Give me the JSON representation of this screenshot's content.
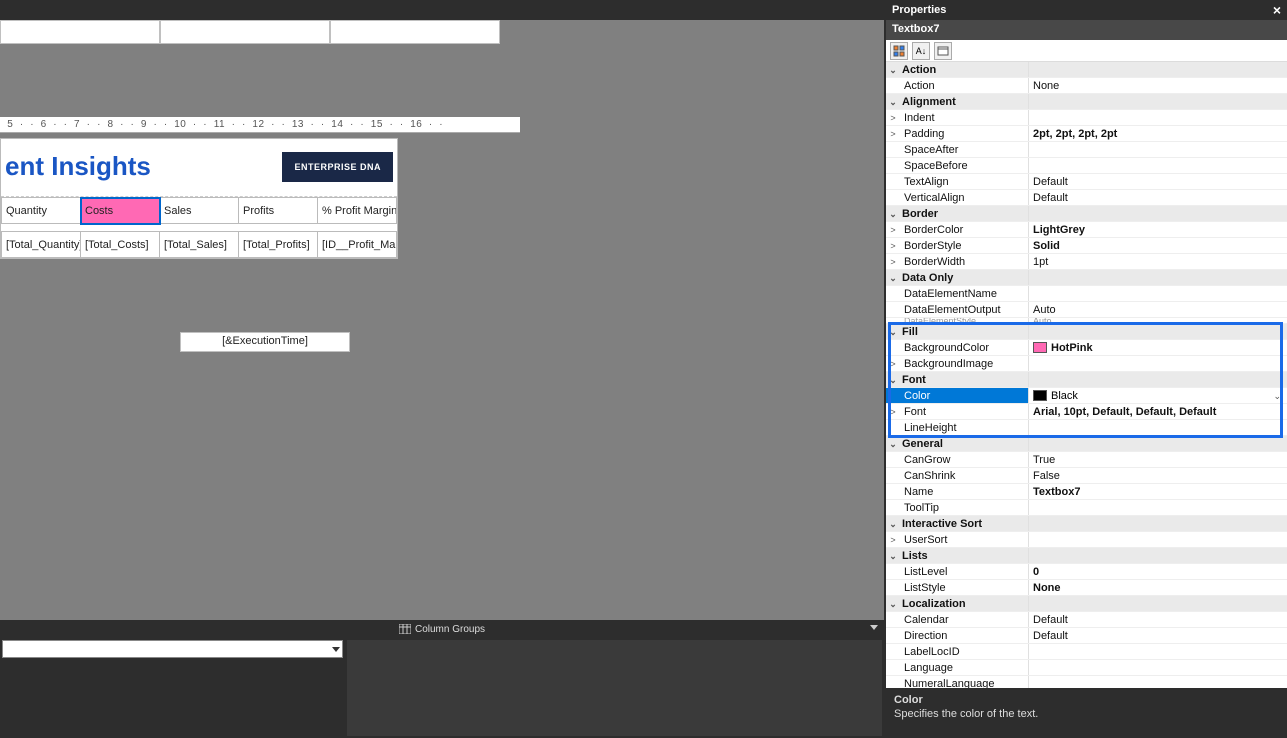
{
  "app": {
    "properties_title": "Properties",
    "object_name": "Textbox7"
  },
  "ruler": " 5  ·  ·  6  ·  ·  7  ·  ·  8  ·  ·  9  ·  ·  10  ·  ·  11  ·  ·  12  ·  ·  13  ·  ·  14  ·  ·  15  ·  ·  16  ·  ·",
  "report": {
    "title": "ent Insights",
    "logo": "ENTERPRISE DNA",
    "columns": [
      "Quantity",
      "Costs",
      "Sales",
      "Profits",
      "% Profit Margin"
    ],
    "fields": [
      "[Total_Quantity]",
      "[Total_Costs]",
      "[Total_Sales]",
      "[Total_Profits]",
      "[ID__Profit_Mar"
    ],
    "selected_header": "Costs",
    "execution_time": "[&ExecutionTime]"
  },
  "groups": {
    "column_groups_label": "Column Groups"
  },
  "categories": [
    {
      "name": "Action",
      "rows": [
        {
          "label": "Action",
          "value": "None"
        }
      ]
    },
    {
      "name": "Alignment",
      "rows": [
        {
          "label": "Indent",
          "value": "",
          "expander": ">"
        },
        {
          "label": "Padding",
          "value": "2pt, 2pt, 2pt, 2pt",
          "bold": true,
          "expander": ">"
        },
        {
          "label": "SpaceAfter",
          "value": ""
        },
        {
          "label": "SpaceBefore",
          "value": ""
        },
        {
          "label": "TextAlign",
          "value": "Default"
        },
        {
          "label": "VerticalAlign",
          "value": "Default"
        }
      ]
    },
    {
      "name": "Border",
      "rows": [
        {
          "label": "BorderColor",
          "value": "LightGrey",
          "bold": true,
          "expander": ">"
        },
        {
          "label": "BorderStyle",
          "value": "Solid",
          "bold": true,
          "expander": ">"
        },
        {
          "label": "BorderWidth",
          "value": "1pt",
          "expander": ">"
        }
      ]
    },
    {
      "name": "Data Only",
      "rows": [
        {
          "label": "DataElementName",
          "value": ""
        },
        {
          "label": "DataElementOutput",
          "value": "Auto"
        },
        {
          "label": "DataElementStyle",
          "value": "Auto",
          "clipped": true
        }
      ]
    },
    {
      "name": "Fill",
      "highlight": true,
      "rows": [
        {
          "label": "BackgroundColor",
          "value": "HotPink",
          "bold": true,
          "swatch": "#ff69b4"
        },
        {
          "label": "BackgroundImage",
          "value": "",
          "expander": ">"
        }
      ]
    },
    {
      "name": "Font",
      "highlight": true,
      "rows": [
        {
          "label": "Color",
          "value": "Black",
          "swatch": "#000000",
          "selected": true,
          "editing": true,
          "dropdown": true
        },
        {
          "label": "Font",
          "value": "Arial, 10pt, Default, Default, Default",
          "bold": true,
          "expander": ">"
        },
        {
          "label": "LineHeight",
          "value": ""
        }
      ]
    },
    {
      "name": "General",
      "rows": [
        {
          "label": "CanGrow",
          "value": "True"
        },
        {
          "label": "CanShrink",
          "value": "False"
        },
        {
          "label": "Name",
          "value": "Textbox7",
          "bold": true
        },
        {
          "label": "ToolTip",
          "value": ""
        }
      ]
    },
    {
      "name": "Interactive Sort",
      "rows": [
        {
          "label": "UserSort",
          "value": "",
          "expander": ">"
        }
      ]
    },
    {
      "name": "Lists",
      "rows": [
        {
          "label": "ListLevel",
          "value": "0",
          "bold": true
        },
        {
          "label": "ListStyle",
          "value": "None",
          "bold": true
        }
      ]
    },
    {
      "name": "Localization",
      "rows": [
        {
          "label": "Calendar",
          "value": "Default"
        },
        {
          "label": "Direction",
          "value": "Default"
        },
        {
          "label": "LabelLocID",
          "value": ""
        },
        {
          "label": "Language",
          "value": ""
        },
        {
          "label": "NumeralLanguage",
          "value": ""
        }
      ]
    }
  ],
  "description": {
    "title": "Color",
    "text": "Specifies the color of the text."
  }
}
